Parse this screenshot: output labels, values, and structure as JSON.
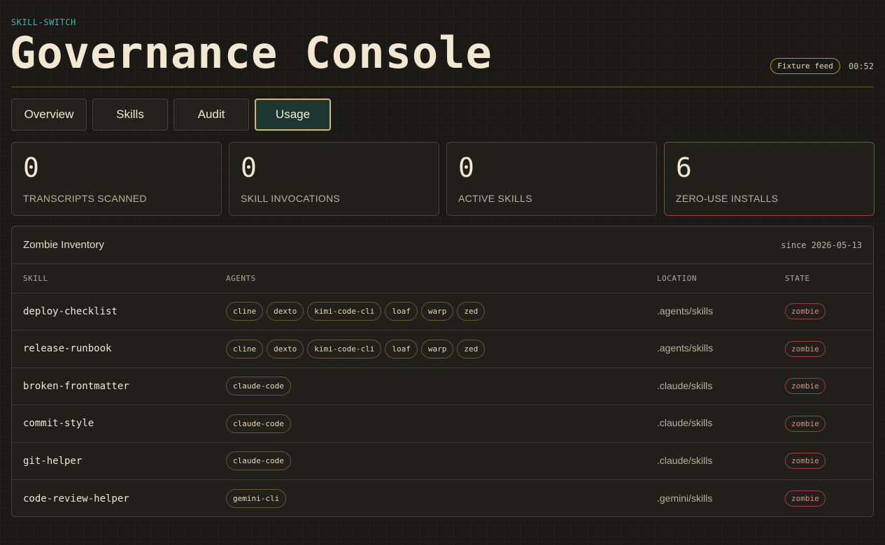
{
  "header": {
    "eyebrow": "SKILL-SWITCH",
    "title": "Governance Console",
    "feed_label": "Fixture feed",
    "clock": "00:52"
  },
  "tabs": [
    {
      "label": "Overview",
      "active": false
    },
    {
      "label": "Skills",
      "active": false
    },
    {
      "label": "Audit",
      "active": false
    },
    {
      "label": "Usage",
      "active": true
    }
  ],
  "stats": [
    {
      "value": "0",
      "label": "TRANSCRIPTS SCANNED"
    },
    {
      "value": "0",
      "label": "SKILL INVOCATIONS"
    },
    {
      "value": "0",
      "label": "ACTIVE SKILLS"
    },
    {
      "value": "6",
      "label": "ZERO-USE INSTALLS"
    }
  ],
  "inventory": {
    "title": "Zombie Inventory",
    "since": "since 2026-05-13",
    "columns": [
      "SKILL",
      "AGENTS",
      "LOCATION",
      "STATE"
    ],
    "rows": [
      {
        "skill": "deploy-checklist",
        "agents": [
          "cline",
          "dexto",
          "kimi-code-cli",
          "loaf",
          "warp",
          "zed"
        ],
        "location": ".agents/skills",
        "state": "zombie"
      },
      {
        "skill": "release-runbook",
        "agents": [
          "cline",
          "dexto",
          "kimi-code-cli",
          "loaf",
          "warp",
          "zed"
        ],
        "location": ".agents/skills",
        "state": "zombie"
      },
      {
        "skill": "broken-frontmatter",
        "agents": [
          "claude-code"
        ],
        "location": ".claude/skills",
        "state": "zombie"
      },
      {
        "skill": "commit-style",
        "agents": [
          "claude-code"
        ],
        "location": ".claude/skills",
        "state": "zombie"
      },
      {
        "skill": "git-helper",
        "agents": [
          "claude-code"
        ],
        "location": ".claude/skills",
        "state": "zombie"
      },
      {
        "skill": "code-review-helper",
        "agents": [
          "gemini-cli"
        ],
        "location": ".gemini/skills",
        "state": "zombie"
      }
    ]
  },
  "colors": {
    "accent_teal": "#3fb5a3",
    "accent_gold": "#d9b56a",
    "alert_red": "#9e3b3b",
    "background": "#1a1915"
  }
}
